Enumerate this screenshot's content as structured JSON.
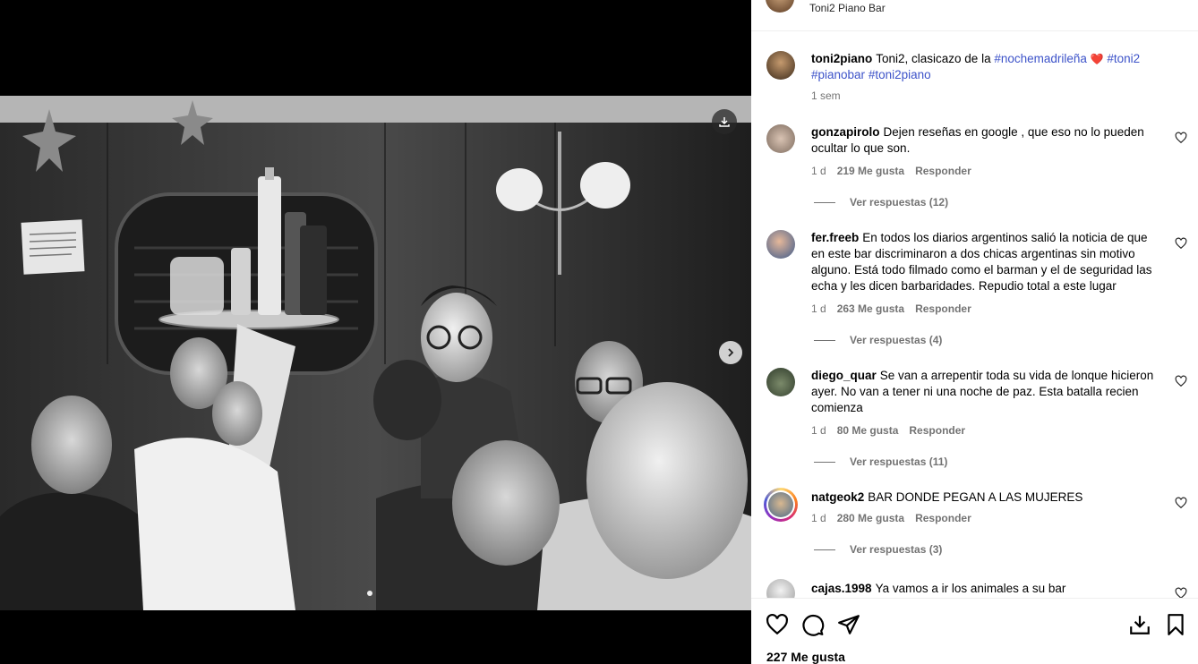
{
  "header": {
    "location": "Toni2 Piano Bar"
  },
  "caption": {
    "username": "toni2piano",
    "text_before": "Toni2, clasicazo de la ",
    "tag1": "#nochemadrileña",
    "heart": "❤️",
    "tag2": "#toni2",
    "tag3": "#pianobar",
    "tag4": "#toni2piano",
    "time": "1 sem"
  },
  "comments": [
    {
      "username": "gonzapirolo",
      "text": "Dejen reseñas en google , que eso no lo pueden ocultar lo que son.",
      "time": "1 d",
      "likes": "219 Me gusta",
      "reply": "Responder",
      "replies": "Ver respuestas (12)"
    },
    {
      "username": "fer.freeb",
      "text": "En todos los diarios argentinos salió la noticia de que en este bar discriminaron a dos chicas argentinas sin motivo alguno. Está todo filmado como el barman y el de seguridad las echa y les dicen barbaridades. Repudio total a este lugar",
      "time": "1 d",
      "likes": "263 Me gusta",
      "reply": "Responder",
      "replies": "Ver respuestas (4)"
    },
    {
      "username": "diego_quar",
      "text": "Se van a arrepentir toda su vida de lonque hicieron ayer. No van a tener ni una noche de paz. Esta batalla recien comienza",
      "time": "1 d",
      "likes": "80 Me gusta",
      "reply": "Responder",
      "replies": "Ver respuestas (11)"
    },
    {
      "username": "natgeok2",
      "text": "BAR DONDE PEGAN A LAS MUJERES",
      "time": "1 d",
      "likes": "280 Me gusta",
      "reply": "Responder",
      "replies": "Ver respuestas (3)"
    },
    {
      "username": "cajas.1998",
      "text": "Ya vamos a ir los animales a su bar"
    }
  ],
  "actions": {
    "like_icon": "heart-icon",
    "comment_icon": "comment-bubble-icon",
    "share_icon": "paper-plane-icon",
    "save_icon": "bookmark-icon",
    "download_icon": "download-icon"
  },
  "likes_total": "227 Me gusta",
  "colors": {
    "hashtag": "#3d53c9",
    "heart": "#ed4956",
    "muted": "#737373"
  }
}
